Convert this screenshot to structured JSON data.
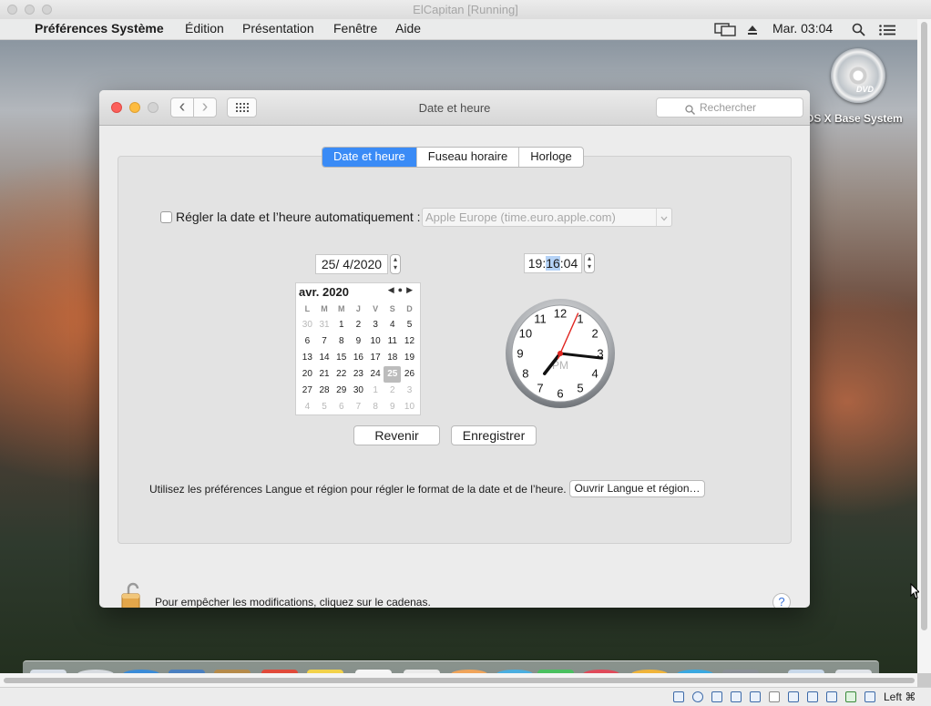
{
  "host": {
    "title": "ElCapitan [Running]",
    "host_key_label": "Left ⌘"
  },
  "menubar": {
    "apple_icon": "",
    "app_name": "Préférences Système",
    "items": [
      "Édition",
      "Présentation",
      "Fenêtre",
      "Aide"
    ],
    "clock": "Mar. 03:04",
    "icons": [
      "display-mirroring-icon",
      "eject-icon",
      "spotlight-search-icon",
      "notification-center-icon"
    ]
  },
  "desktop": {
    "dvd_label": "OS X Base System",
    "dvd_text": "DVD"
  },
  "window": {
    "title": "Date et heure",
    "back_icon": "‹",
    "forward_icon": "›",
    "grid_icon": "⋮⋮⋮",
    "search_placeholder": "Rechercher",
    "tabs": [
      "Date et heure",
      "Fuseau horaire",
      "Horloge"
    ],
    "active_tab": 0,
    "auto_set_label": "Régler la date et l’heure automatiquement :",
    "auto_set_checked": false,
    "time_server": "Apple Europe (time.euro.apple.com)",
    "date_day": "25",
    "date_month": "4",
    "date_year": "2020",
    "time_hours": "19",
    "time_minutes": "16",
    "time_seconds": "04",
    "calendar": {
      "month_label": "avr. 2020",
      "weekdays": [
        "L",
        "M",
        "M",
        "J",
        "V",
        "S",
        "D"
      ],
      "weeks": [
        [
          "30",
          "31",
          "1",
          "2",
          "3",
          "4",
          "5"
        ],
        [
          "6",
          "7",
          "8",
          "9",
          "10",
          "11",
          "12"
        ],
        [
          "13",
          "14",
          "15",
          "16",
          "17",
          "18",
          "19"
        ],
        [
          "20",
          "21",
          "22",
          "23",
          "24",
          "25",
          "26"
        ],
        [
          "27",
          "28",
          "29",
          "30",
          "1",
          "2",
          "3"
        ],
        [
          "4",
          "5",
          "6",
          "7",
          "8",
          "9",
          "10"
        ]
      ],
      "selected_day": "25"
    },
    "clock": {
      "numbers": [
        "12",
        "1",
        "2",
        "3",
        "4",
        "5",
        "6",
        "7",
        "8",
        "9",
        "10",
        "11"
      ],
      "ampm": "PM",
      "hour": 7,
      "minute": 16,
      "second": 4
    },
    "revert_label": "Revenir",
    "save_label": "Enregistrer",
    "info_text": "Utilisez les préférences Langue et région pour régler le format de la date et de l’heure.",
    "open_language_label": "Ouvrir Langue et région…",
    "lock_text": "Pour empêcher les modifications, cliquez sur le cadenas.",
    "help_label": "?"
  },
  "colors": {
    "accent": "#3a8bf6",
    "close": "#fc605b",
    "minimize": "#fdbc40",
    "second_hand": "#e0241f"
  }
}
